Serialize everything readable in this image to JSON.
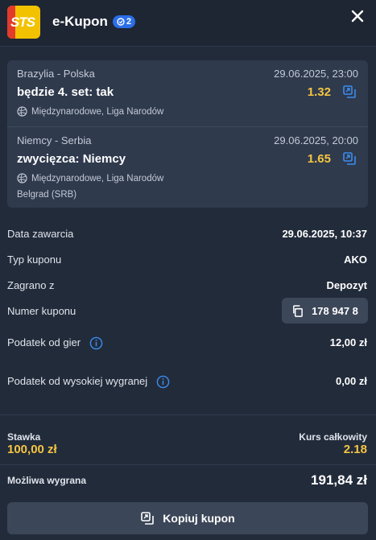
{
  "header": {
    "logo_text": "STS",
    "title": "e-Kupon",
    "bet_count": "2"
  },
  "events": [
    {
      "teams": "Brazylia - Polska",
      "datetime": "29.06.2025, 23:00",
      "pick": "będzie 4. set: tak",
      "odds": "1.32",
      "league": "Międzynarodowe, Liga Narodów",
      "venue": ""
    },
    {
      "teams": "Niemcy - Serbia",
      "datetime": "29.06.2025, 20:00",
      "pick": "zwycięzca: Niemcy",
      "odds": "1.65",
      "league": "Międzynarodowe, Liga Narodów",
      "venue": "Belgrad (SRB)"
    }
  ],
  "details": {
    "date_label": "Data zawarcia",
    "date_value": "29.06.2025, 10:37",
    "type_label": "Typ kuponu",
    "type_value": "AKO",
    "played_from_label": "Zagrano z",
    "played_from_value": "Depozyt",
    "coupon_number_label": "Numer kuponu",
    "coupon_number_value": "178 947 8",
    "game_tax_label": "Podatek od gier",
    "game_tax_value": "12,00 zł",
    "high_win_tax_label": "Podatek od wysokiej wygranej",
    "high_win_tax_value": "0,00 zł"
  },
  "summary": {
    "stake_label": "Stawka",
    "stake_value": "100,00 zł",
    "total_odds_label": "Kurs całkowity",
    "total_odds_value": "2.18",
    "possible_win_label": "Możliwa wygrana",
    "possible_win_value": "191,84 zł"
  },
  "actions": {
    "copy_label": "Kopiuj kupon"
  },
  "colors": {
    "background": "#222b3a",
    "card": "#2f3a4d",
    "accent_yellow": "#f5c542",
    "accent_blue": "#3c8cf0",
    "badge_blue": "#2b6ee8"
  }
}
